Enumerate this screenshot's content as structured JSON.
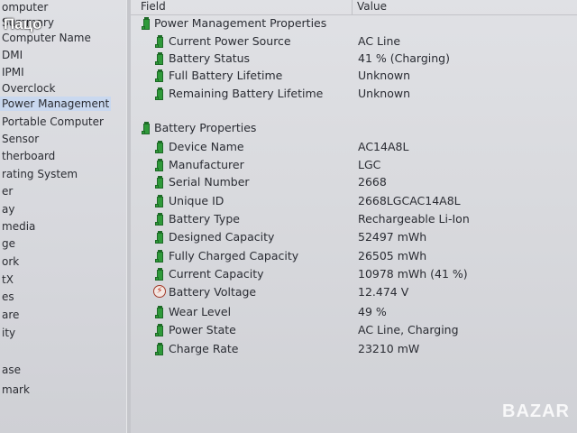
{
  "overlay": {
    "logo_text": "Пацо",
    "watermark_text": "BAZAR"
  },
  "tree": {
    "items": [
      {
        "label": "omputer"
      },
      {
        "label": "Summary"
      },
      {
        "label": "Computer Name"
      },
      {
        "label": "DMI"
      },
      {
        "label": "IPMI"
      },
      {
        "label": "Overclock"
      },
      {
        "label": "Power Management",
        "selected": true
      },
      {
        "label": "Portable Computer"
      },
      {
        "label": "Sensor"
      },
      {
        "label": "therboard"
      },
      {
        "label": "rating System"
      },
      {
        "label": "er"
      },
      {
        "label": "ay"
      },
      {
        "label": "media"
      },
      {
        "label": "ge"
      },
      {
        "label": "ork"
      },
      {
        "label": "tX"
      },
      {
        "label": "es"
      },
      {
        "label": "are"
      },
      {
        "label": "ity"
      },
      {
        "label": "ase"
      },
      {
        "label": "mark"
      }
    ]
  },
  "columns": {
    "field": "Field",
    "value": "Value"
  },
  "rows": [
    {
      "field": "Power Management Properties",
      "value": "",
      "level": 0,
      "icon": "battery-icon"
    },
    {
      "field": "Current Power Source",
      "value": "AC Line",
      "level": 1,
      "icon": "battery-icon"
    },
    {
      "field": "Battery Status",
      "value": "41 % (Charging)",
      "level": 1,
      "icon": "battery-icon"
    },
    {
      "field": "Full Battery Lifetime",
      "value": "Unknown",
      "level": 1,
      "icon": "battery-icon"
    },
    {
      "field": "Remaining Battery Lifetime",
      "value": "Unknown",
      "level": 1,
      "icon": "battery-icon"
    },
    {
      "field": "Battery Properties",
      "value": "",
      "level": 0,
      "icon": "battery-icon"
    },
    {
      "field": "Device Name",
      "value": "AC14A8L",
      "level": 1,
      "icon": "battery-icon"
    },
    {
      "field": "Manufacturer",
      "value": "LGC",
      "level": 1,
      "icon": "battery-icon"
    },
    {
      "field": "Serial Number",
      "value": "2668",
      "level": 1,
      "icon": "battery-icon"
    },
    {
      "field": "Unique ID",
      "value": "2668LGCAC14A8L",
      "level": 1,
      "icon": "battery-icon"
    },
    {
      "field": "Battery Type",
      "value": "Rechargeable Li-Ion",
      "level": 1,
      "icon": "battery-icon"
    },
    {
      "field": "Designed Capacity",
      "value": "52497 mWh",
      "level": 1,
      "icon": "battery-icon"
    },
    {
      "field": "Fully Charged Capacity",
      "value": "26505 mWh",
      "level": 1,
      "icon": "battery-icon"
    },
    {
      "field": "Current Capacity",
      "value": "10978 mWh  (41 %)",
      "level": 1,
      "icon": "battery-icon"
    },
    {
      "field": "Battery Voltage",
      "value": "12.474 V",
      "level": 1,
      "icon": "voltage-icon"
    },
    {
      "field": "Wear Level",
      "value": "49 %",
      "level": 1,
      "icon": "battery-icon"
    },
    {
      "field": "Power State",
      "value": "AC Line, Charging",
      "level": 1,
      "icon": "battery-icon"
    },
    {
      "field": "Charge Rate",
      "value": "23210 mW",
      "level": 1,
      "icon": "battery-icon"
    }
  ]
}
